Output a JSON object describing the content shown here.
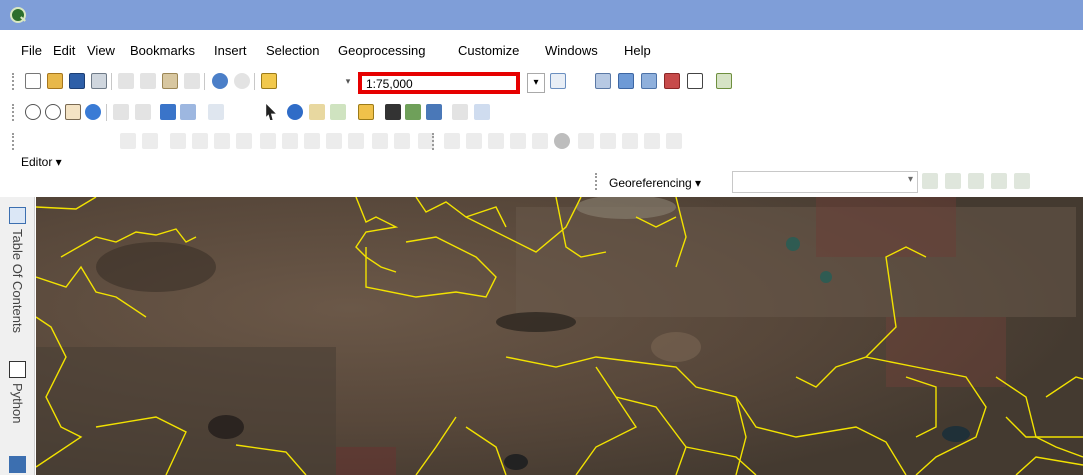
{
  "menu": [
    "File",
    "Edit",
    "View",
    "Bookmarks",
    "Insert",
    "Selection",
    "Geoprocessing",
    "Customize",
    "Windows",
    "Help"
  ],
  "standard_toolbar": {
    "scale_value": "1:75,000"
  },
  "editor_toolbar": {
    "editor_label": "Editor ▾"
  },
  "georef_toolbar": {
    "label": "Georeferencing ▾",
    "layer_value": ""
  },
  "sidebar": {
    "toc_label": "Table Of Contents",
    "python_label": "Python"
  },
  "colors": {
    "titlebar": "#7f9ed8",
    "highlight": "#e60000",
    "polygon_outline": "#f2e200"
  },
  "icons": [
    "app-icon",
    "new-icon",
    "open-icon",
    "save-icon",
    "print-icon",
    "cut-icon",
    "copy-icon",
    "paste-icon",
    "delete-icon",
    "undo-icon",
    "redo-icon",
    "add-data-icon",
    "zoom-in-icon",
    "zoom-out-icon",
    "pan-icon",
    "full-extent-icon",
    "select-icon",
    "identify-icon",
    "find-icon",
    "measure-icon"
  ]
}
